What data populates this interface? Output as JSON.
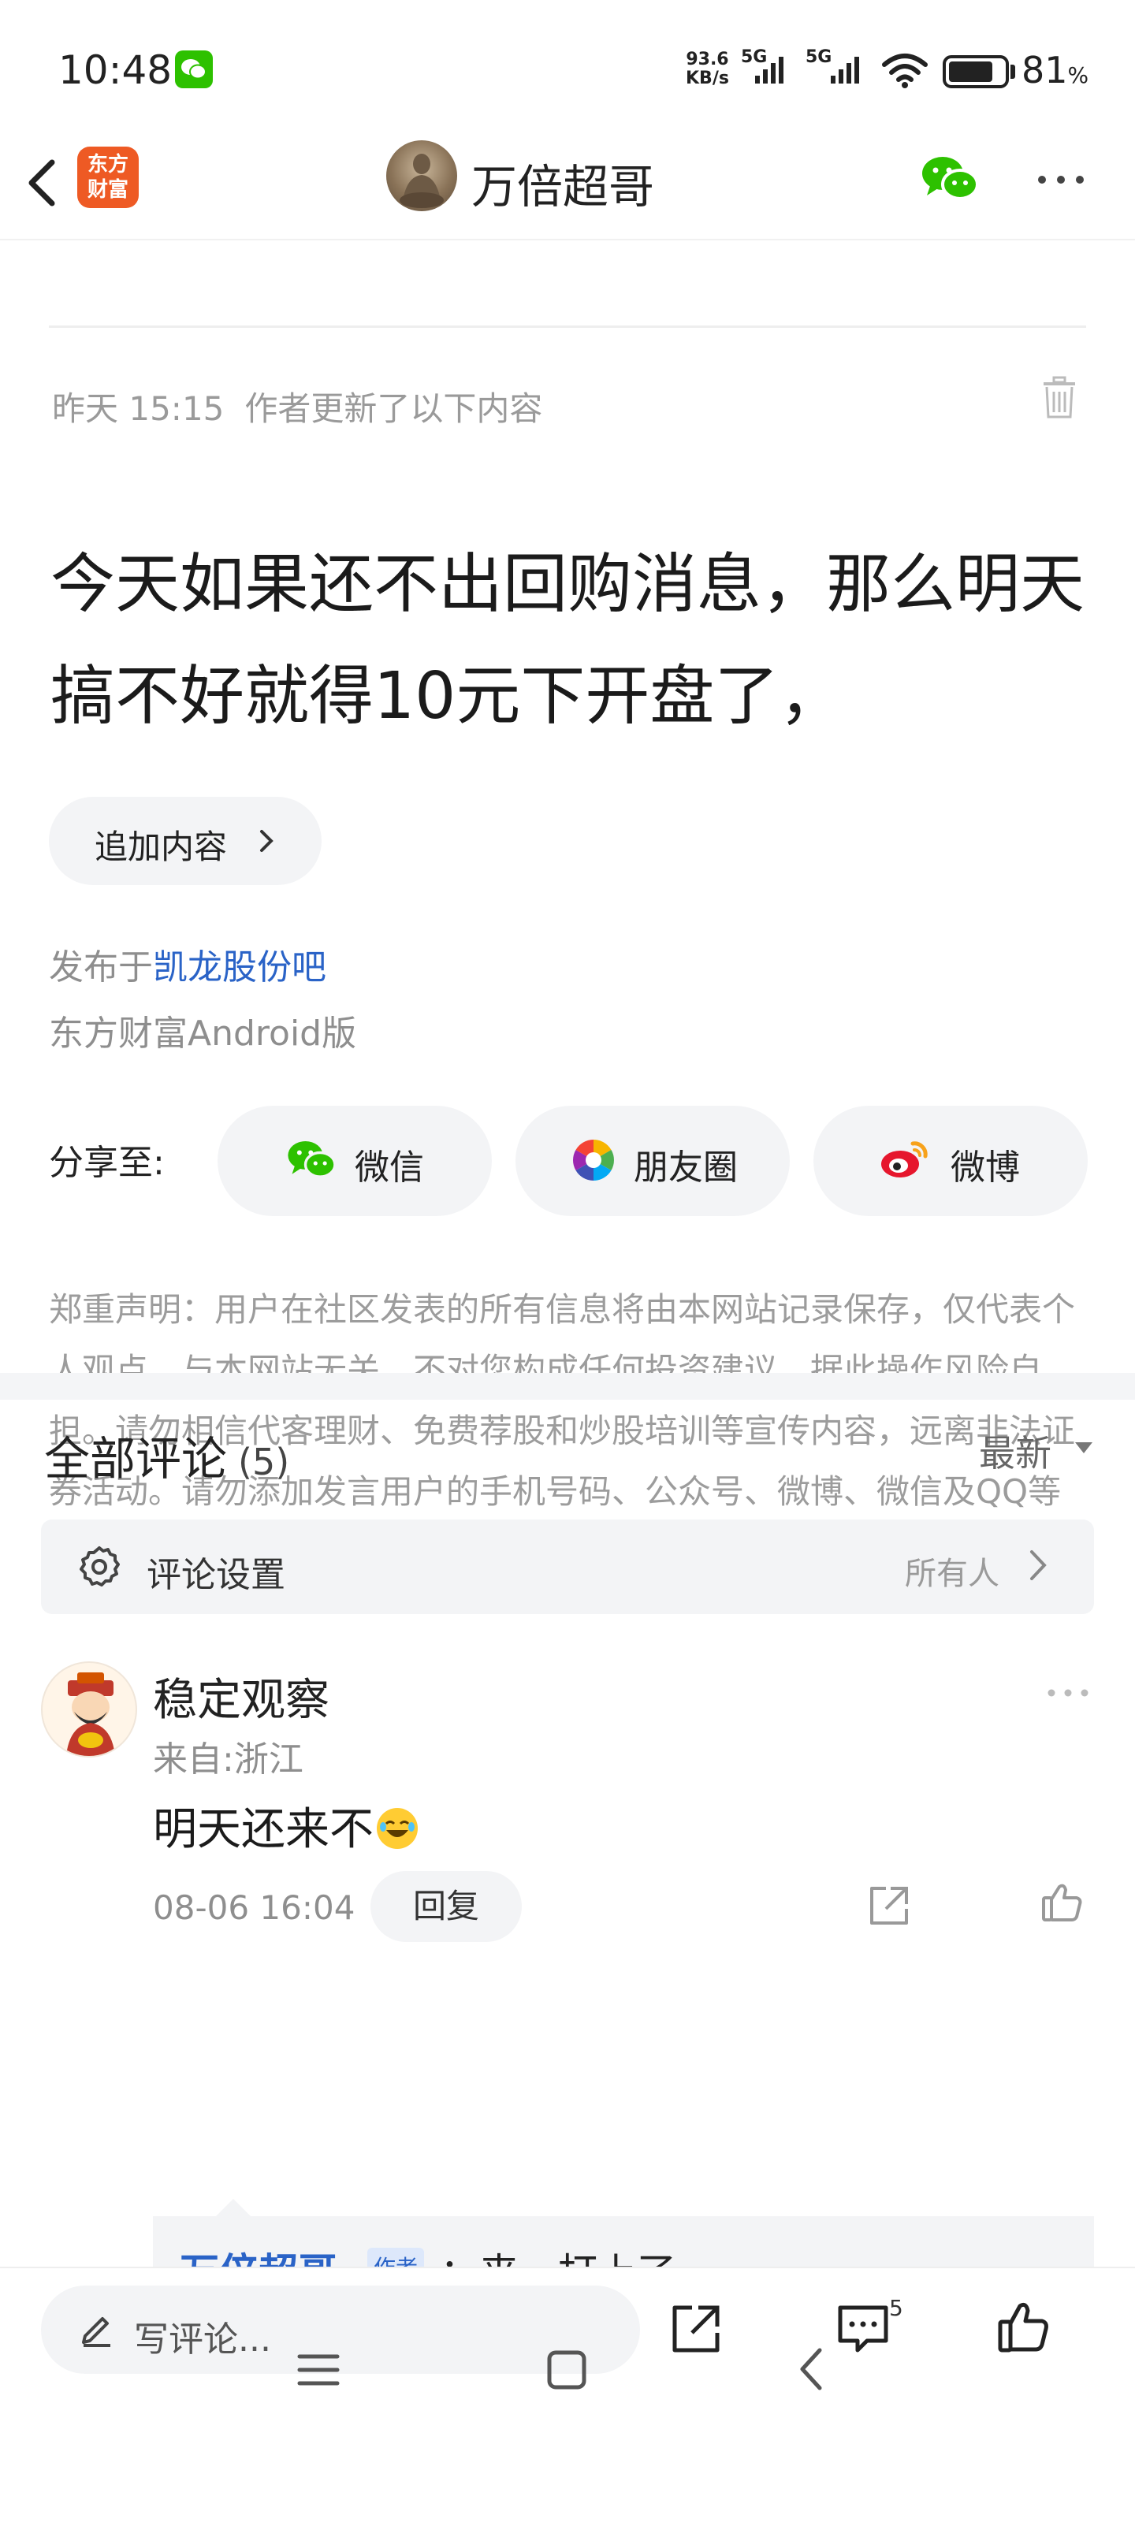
{
  "status_bar": {
    "time": "10:48",
    "net_speed_value": "93.6",
    "net_speed_unit": "KB/s",
    "signal1_label": "5G",
    "signal2_label": "5G",
    "battery_percent": "81",
    "battery_unit": "%",
    "battery_level": 0.81
  },
  "header": {
    "app_logo_line1": "东方",
    "app_logo_line2": "财富",
    "title": "万倍超哥"
  },
  "update": {
    "time": "昨天 15:15",
    "note": "作者更新了以下内容"
  },
  "post": {
    "text": "今天如果还不出回购消息，那么明天搞不好就得10元下开盘了，",
    "append_label": "追加内容",
    "published_prefix": "发布于",
    "published_bar": "凯龙股份吧",
    "client": "东方财富Android版"
  },
  "share": {
    "label": "分享至:",
    "options": [
      {
        "label": "微信",
        "icon": "wechat-icon"
      },
      {
        "label": "朋友圈",
        "icon": "moments-icon"
      },
      {
        "label": "微博",
        "icon": "weibo-icon"
      }
    ]
  },
  "disclaimer": "郑重声明：用户在社区发表的所有信息将由本网站记录保存，仅代表个人观点，与本网站无关，不对您构成任何投资建议，据此操作风险自担。请勿相信代客理财、免费荐股和炒股培训等宣传内容，远离非法证券活动。请勿添加发言用户的手机号码、公众号、微博、微信及QQ等信息，谨防上当受骗！",
  "comments": {
    "title": "全部评论",
    "count": "(5)",
    "sort": "最新",
    "settings_label": "评论设置",
    "settings_value": "所有人",
    "items": [
      {
        "user": "稳定观察",
        "location": "来自:浙江",
        "text": "明天还来不",
        "time": "08-06 16:04",
        "reply_label": "回复",
        "reply": {
          "user": "万倍超哥",
          "tag": "作者",
          "text": "：来，打上了。"
        }
      }
    ]
  },
  "bottom_bar": {
    "placeholder": "写评论...",
    "comment_count": "5"
  },
  "colors": {
    "link_blue": "#2a63c7",
    "brand_orange": "#ee5a24",
    "wechat_green": "#2dc100"
  }
}
